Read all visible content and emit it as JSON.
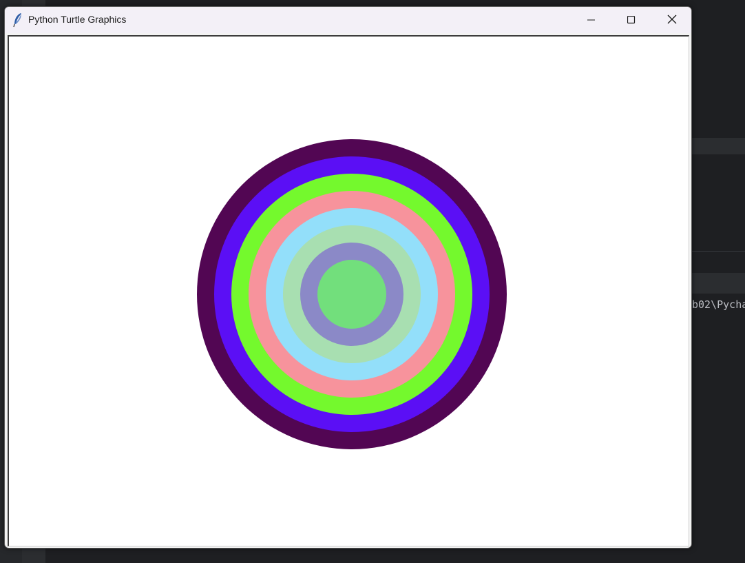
{
  "window": {
    "title": "Python Turtle Graphics",
    "icon": "feather-icon",
    "controls": {
      "minimize_icon": "minimize-icon",
      "maximize_icon": "maximize-icon",
      "close_icon": "close-icon"
    }
  },
  "background": {
    "terminal_snippet": "b02\\Pycha"
  },
  "drawing": {
    "rings_outer_to_inner": [
      {
        "color": "#520653"
      },
      {
        "color": "#5b0ff5"
      },
      {
        "color": "#74f92d"
      },
      {
        "color": "#f7939c"
      },
      {
        "color": "#93dffa"
      },
      {
        "color": "#a8dfb1"
      },
      {
        "color": "#8b89c7"
      },
      {
        "color": "#72df7c"
      }
    ]
  }
}
